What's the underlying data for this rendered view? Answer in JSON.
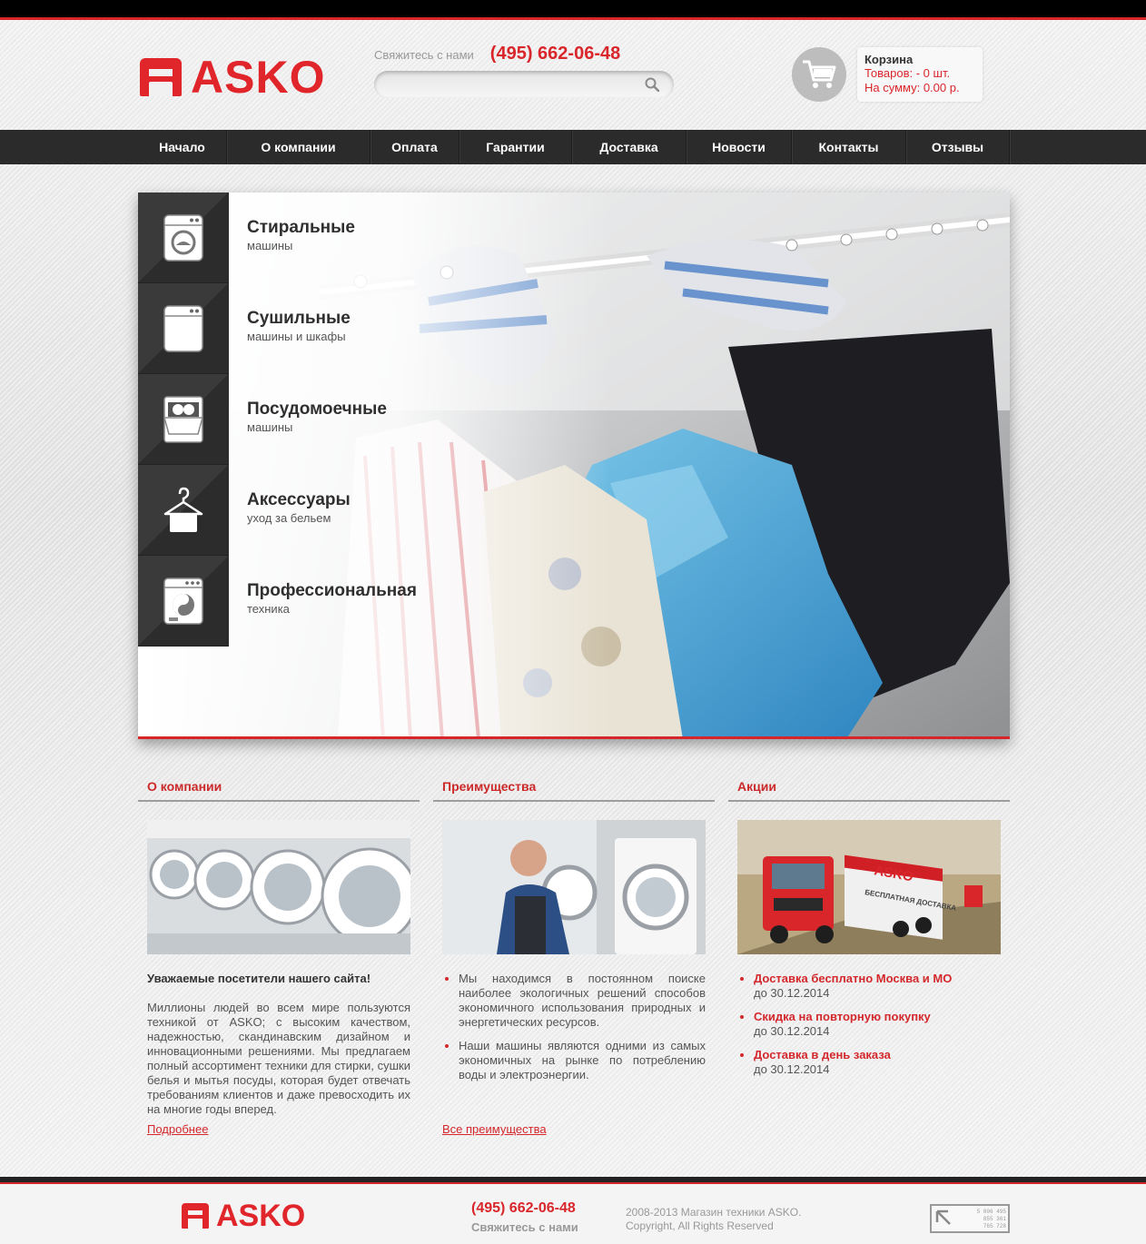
{
  "header": {
    "brand": "ASKO",
    "contact_label": "Свяжитесь с нами",
    "phone": "(495) 662-06-48",
    "search_placeholder": "",
    "cart": {
      "title": "Корзина",
      "items_line": "Товаров: - 0 шт.",
      "sum_line": "На сумму: 0.00 р."
    }
  },
  "nav": {
    "items": [
      {
        "label": "Начало"
      },
      {
        "label": "О компании"
      },
      {
        "label": "Оплата"
      },
      {
        "label": "Гарантии"
      },
      {
        "label": "Доставка"
      },
      {
        "label": "Новости"
      },
      {
        "label": "Контакты"
      },
      {
        "label": "Отзывы"
      }
    ]
  },
  "categories": [
    {
      "title": "Стиральные",
      "subtitle": "машины",
      "icon": "washing-machine-icon"
    },
    {
      "title": "Сушильные",
      "subtitle": "машины и шкафы",
      "icon": "dryer-icon"
    },
    {
      "title": "Посудомоечные",
      "subtitle": "машины",
      "icon": "dishwasher-icon"
    },
    {
      "title": "Аксессуары",
      "subtitle": "уход за бельем",
      "icon": "hanger-icon"
    },
    {
      "title": "Профессиональная",
      "subtitle": "техника",
      "icon": "professional-washer-icon"
    }
  ],
  "about": {
    "heading": "О компании",
    "greeting": "Уважаемые посетители нашего сайта!",
    "text": "Миллионы людей во всем мире пользуются техникой от ASKO; с высоким качеством, надежностью, скандинавским дизайном и инновационными решениями. Мы предлагаем полный ассортимент техники для стирки, сушки белья и мытья посуды, которая будет отвечать требованиям клиентов и даже превосходить их на многие годы вперед.",
    "link": "Подробнее"
  },
  "advantages": {
    "heading": "Преимущества",
    "items": [
      "Мы находимся в постоянном поиске наиболее экологичных решений способов экономичного использования природных и энергетических ресурсов.",
      "Наши машины являются одними из самых экономичных на рынке по потреблению воды и электроэнергии."
    ],
    "link": "Все преимущества"
  },
  "promos": {
    "heading": "Акции",
    "truck_text_brand": "ASKO",
    "truck_text_slogan": "БЕСПЛАТНАЯ ДОСТАВКА",
    "items": [
      {
        "title": "Доставка бесплатно Москва и МО",
        "date": "до 30.12.2014"
      },
      {
        "title": "Скидка на повторную покупку",
        "date": "до 30.12.2014"
      },
      {
        "title": "Доставка в день заказа",
        "date": "до 30.12.2014"
      }
    ]
  },
  "footer": {
    "brand": "ASKO",
    "phone": "(495) 662-06-48",
    "contact_label": "Свяжитесь с нами",
    "copyright_line1": "2008-2013 Магазин техники ASKO.",
    "copyright_line2": "Copyright, All Rights Reserved",
    "counter_digits": [
      "5 006 495",
      "855 361",
      "765 728"
    ]
  },
  "colors": {
    "accent": "#d9262b",
    "nav_bg": "#2b2b2b",
    "topbar": "#000000"
  }
}
